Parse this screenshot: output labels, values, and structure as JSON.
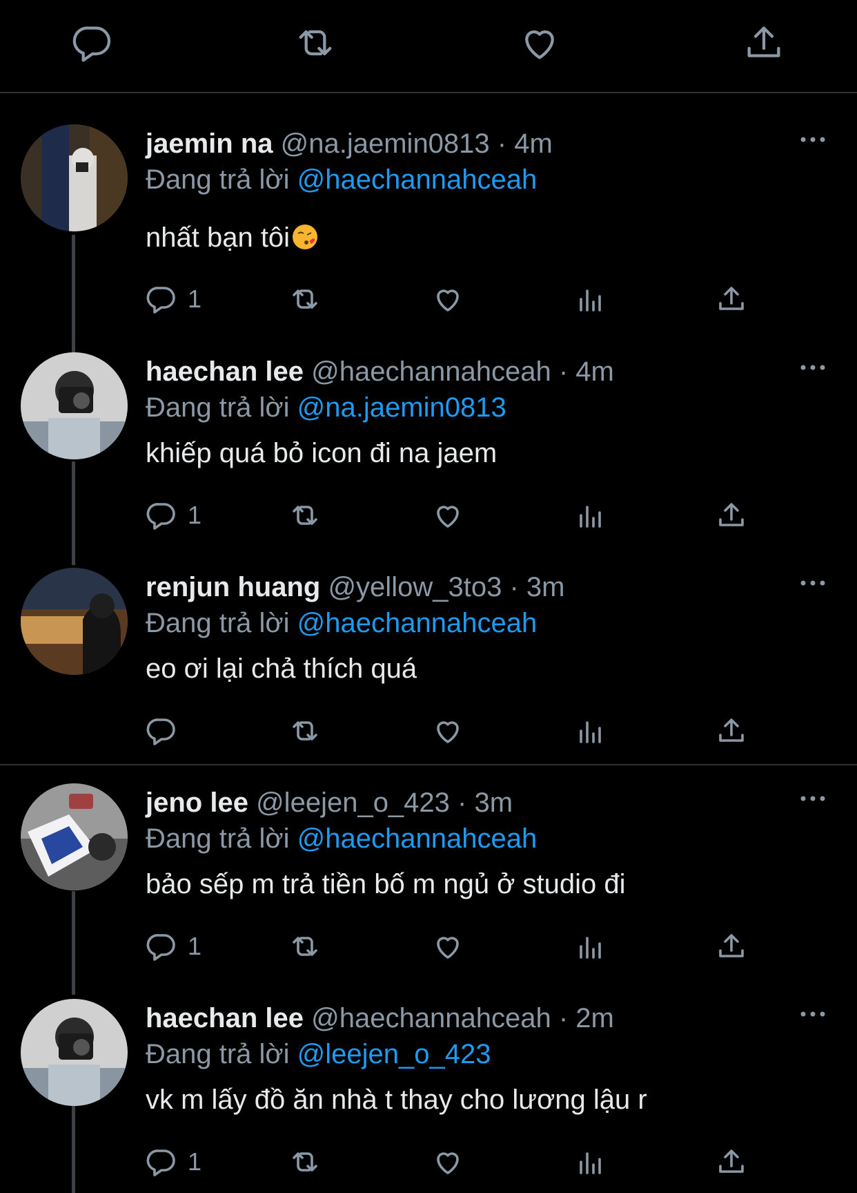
{
  "top_actions": [
    "reply-icon",
    "retweet-icon",
    "like-icon",
    "share-icon"
  ],
  "replying_label": "Đang trả lời",
  "replies": [
    {
      "name": "jaemin na",
      "handle": "@na.jaemin0813",
      "time": "4m",
      "replying_to": "@haechannahceah",
      "text": "nhất bạn tôi",
      "emoji": "kissing-heart-emoji",
      "reply_count": "1"
    },
    {
      "name": "haechan lee",
      "handle": "@haechannahceah",
      "time": "4m",
      "replying_to": "@na.jaemin0813",
      "text": "khiếp quá bỏ icon đi na jaem",
      "reply_count": "1"
    },
    {
      "name": "renjun huang",
      "handle": "@yellow_3to3",
      "time": "3m",
      "replying_to": "@haechannahceah",
      "text": "eo ơi lại chả thích quá",
      "reply_count": ""
    },
    {
      "name": "jeno lee",
      "handle": "@leejen_o_423",
      "time": "3m",
      "replying_to": "@haechannahceah",
      "text": "bảo sếp m trả tiền bố m ngủ ở studio đi",
      "reply_count": "1"
    },
    {
      "name": "haechan lee",
      "handle": "@haechannahceah",
      "time": "2m",
      "replying_to": "@leejen_o_423",
      "text": "vk m lấy đồ ăn nhà t thay cho lương lậu r",
      "reply_count": "1"
    }
  ],
  "colors": {
    "background": "#000000",
    "text": "#e7e9ea",
    "muted": "#8b98a5",
    "mention": "#1d9bf0",
    "divider": "#2f3336"
  }
}
